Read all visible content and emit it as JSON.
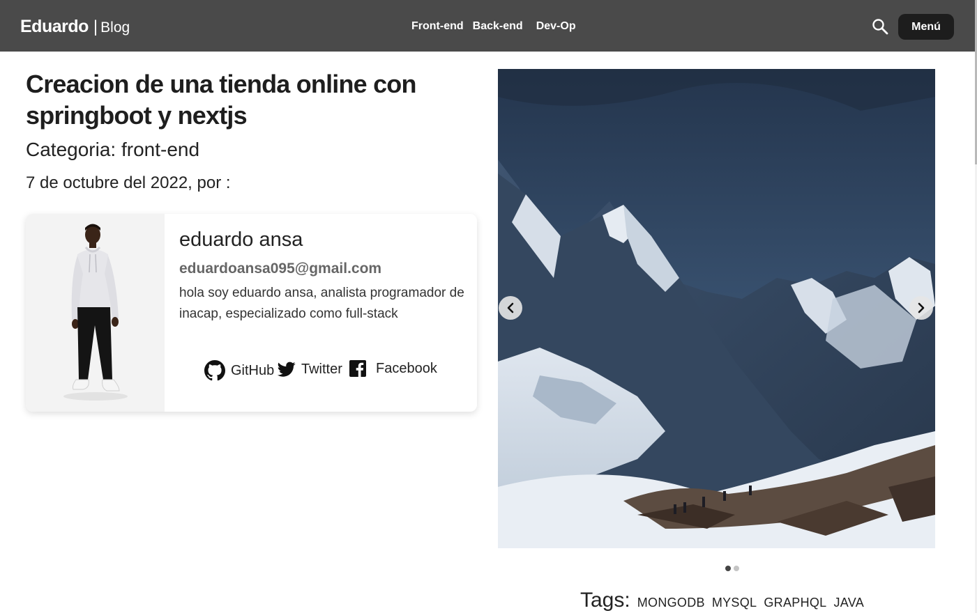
{
  "header": {
    "brand_name": "Eduardo",
    "brand_separator": "|",
    "brand_sub": "Blog",
    "nav": [
      "Front-end",
      "Back-end",
      "Dev-Op"
    ],
    "menu_label": "Menú",
    "colors": {
      "bar": "#4a4a4a",
      "menu_button": "#1d1d1d"
    }
  },
  "post": {
    "title": "Creacion de una tienda online con springboot y nextjs",
    "category": "Categoria: front-end",
    "date_line": "7 de octubre del 2022, por :"
  },
  "author": {
    "name": "eduardo ansa",
    "email": "eduardoansa095@gmail.com",
    "bio": "hola soy eduardo ansa, analista programador de inacap, especializado como full-stack",
    "social": [
      {
        "icon": "github-icon",
        "label": "GitHub"
      },
      {
        "icon": "twitter-icon",
        "label": "Twitter"
      },
      {
        "icon": "facebook-icon",
        "label": "Facebook"
      }
    ]
  },
  "carousel": {
    "slide_count": 2,
    "active_index": 0,
    "prev_icon": "chevron-left-icon",
    "next_icon": "chevron-right-icon"
  },
  "tags": {
    "label": "Tags:",
    "items": [
      "MONGODB",
      "MYSQL",
      "GRAPHQL",
      "JAVA"
    ]
  }
}
